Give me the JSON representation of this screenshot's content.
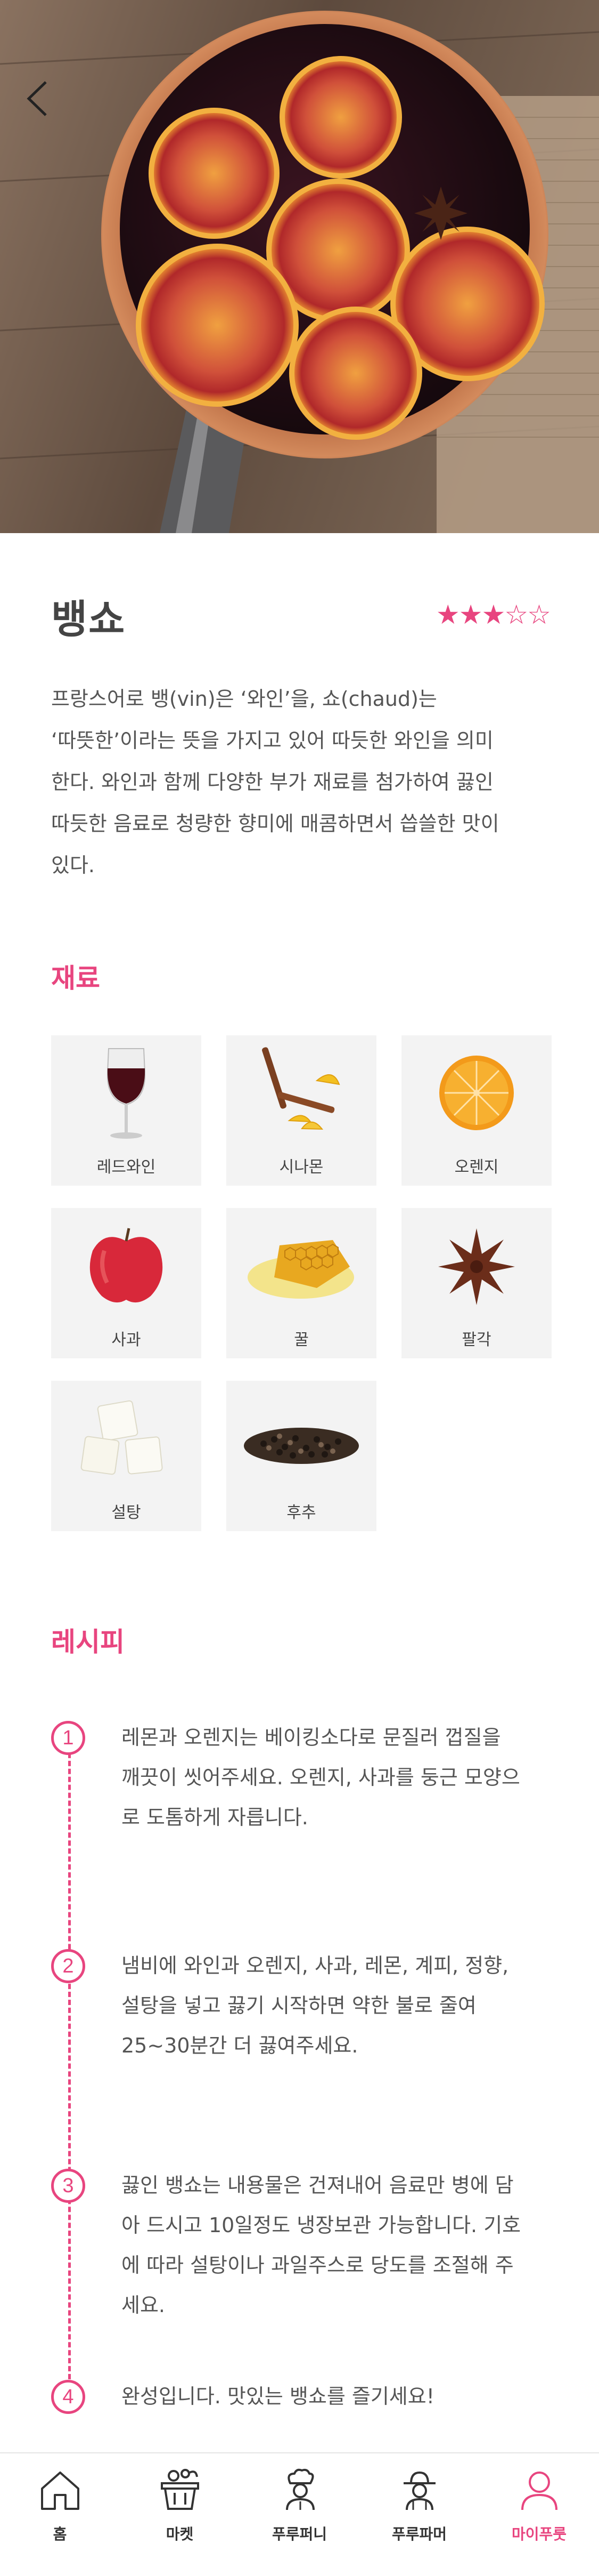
{
  "header": {
    "back_icon": "chevron-left-icon"
  },
  "recipe": {
    "title": "뱅쇼",
    "difficulty": {
      "filled": 3,
      "total": 5,
      "display": "★★★☆☆"
    },
    "description": "프랑스어로 뱅(vin)은 ‘와인’을, 쇼(chaud)는\n‘따뜻한’이라는 뜻을 가지고 있어 따듯한 와인을 의미\n한다. 와인과 함께 다양한 부가 재료를 첨가하여 끓인\n따듯한 음료로 청량한 향미에 매콤하면서 씁쓸한 맛이\n있다."
  },
  "ingredients": {
    "heading": "재료",
    "items": [
      {
        "label": "레드와인",
        "icon": "red-wine-icon"
      },
      {
        "label": "시나몬",
        "icon": "cinnamon-icon"
      },
      {
        "label": "오렌지",
        "icon": "orange-icon"
      },
      {
        "label": "사과",
        "icon": "apple-icon"
      },
      {
        "label": "꿀",
        "icon": "honey-icon"
      },
      {
        "label": "팔각",
        "icon": "star-anise-icon"
      },
      {
        "label": "설탕",
        "icon": "sugar-icon"
      },
      {
        "label": "후추",
        "icon": "pepper-icon"
      }
    ]
  },
  "steps": {
    "heading": "레시피",
    "items": [
      {
        "num": "1",
        "text": "레몬과 오렌지는 베이킹소다로 문질러 껍질을\n깨끗이 씻어주세요. 오렌지, 사과를 둥근 모양으\n로 도톰하게 자릅니다."
      },
      {
        "num": "2",
        "text": "냄비에 와인과 오렌지, 사과, 레몬, 계피, 정향,\n설탕을 넣고 끓기 시작하면 약한 불로 줄여\n25~30분간 더 끓여주세요."
      },
      {
        "num": "3",
        "text": "끓인 뱅쇼는 내용물은 건져내어 음료만 병에 담\n아 드시고 10일정도 냉장보관 가능합니다. 기호\n에 따라 설탕이나 과일주스로 당도를 조절해 주\n세요."
      },
      {
        "num": "4",
        "text": "완성입니다. 맛있는 뱅쇼를 즐기세요!"
      }
    ]
  },
  "bottom_nav": {
    "items": [
      {
        "label": "홈",
        "icon": "home-icon"
      },
      {
        "label": "마켓",
        "icon": "market-basket-icon"
      },
      {
        "label": "푸루퍼니",
        "icon": "chef-icon"
      },
      {
        "label": "푸루파머",
        "icon": "farmer-icon"
      },
      {
        "label": "마이푸룻",
        "icon": "user-icon"
      }
    ],
    "active_index": 4
  },
  "colors": {
    "accent": "#e8457f",
    "text": "#555555",
    "tile_bg": "#f3f3f3"
  }
}
